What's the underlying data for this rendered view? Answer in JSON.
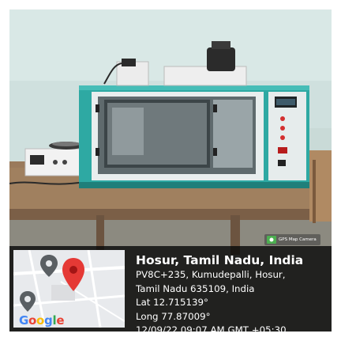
{
  "overlay": {
    "badge": "GPS Map Camera",
    "title": "Hosur, Tamil Nadu, India",
    "address_1": "PV8C+235, Kumudepalli, Hosur,",
    "address_2": "Tamil Nadu 635109, India",
    "latitude": "Lat 12.715139°",
    "longitude": "Long 77.87009°",
    "timestamp": "12/09/22 09:07 AM GMT +05:30"
  },
  "map": {
    "logo": [
      "G",
      "o",
      "o",
      "g",
      "l",
      "e"
    ],
    "logo_colors": [
      "#4285F4",
      "#EA4335",
      "#FBBC05",
      "#4285F4",
      "#34A853",
      "#EA4335"
    ],
    "pin_color": "#E53935"
  },
  "colors": {
    "cabinet": "#2ea9a3",
    "wall": "#cfe0de",
    "table": "#9a7a5c"
  }
}
